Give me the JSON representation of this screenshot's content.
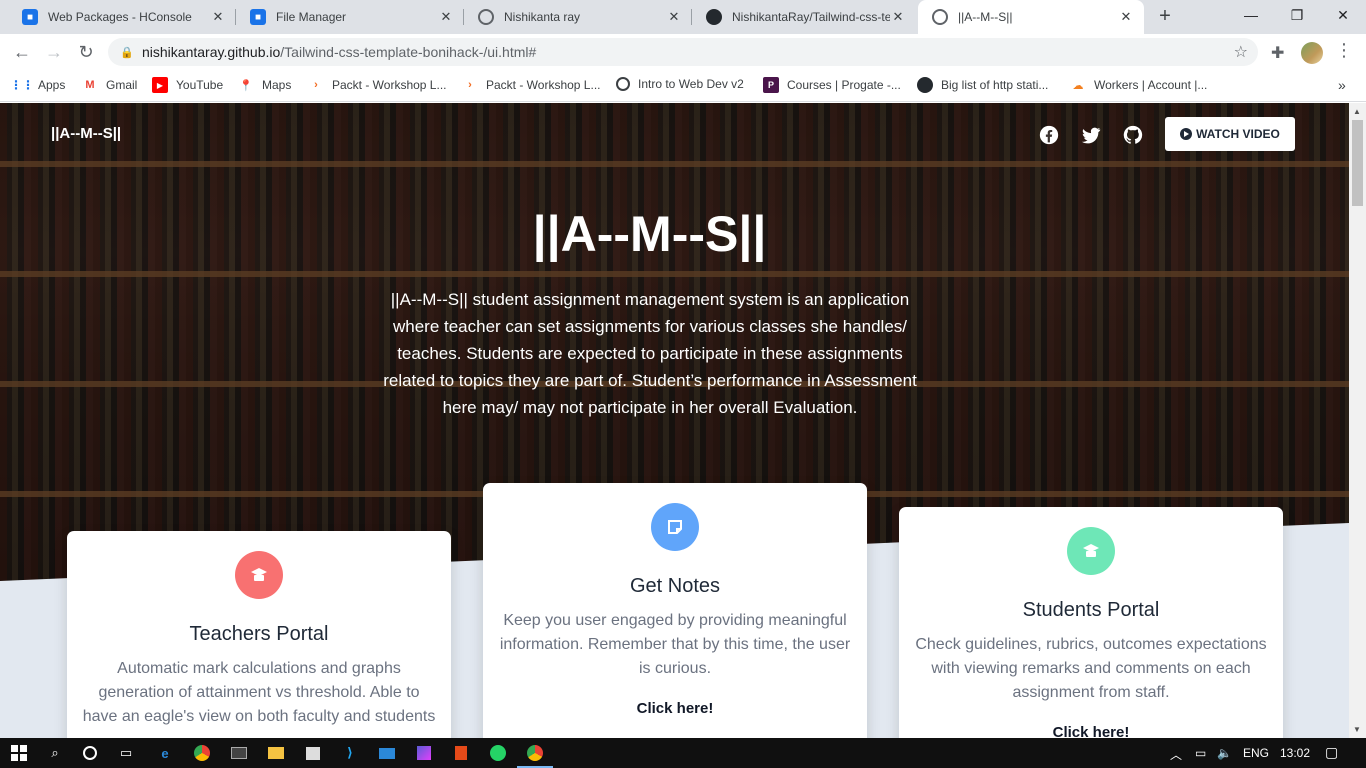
{
  "browser": {
    "tabs": [
      {
        "title": "Web Packages - HConsole",
        "active": false,
        "favicon": "hconsole-icon"
      },
      {
        "title": "File Manager",
        "active": false,
        "favicon": "file-manager-icon"
      },
      {
        "title": "Nishikanta ray",
        "active": false,
        "favicon": "globe-icon"
      },
      {
        "title": "NishikantaRay/Tailwind-css-ter",
        "active": false,
        "favicon": "github-icon"
      },
      {
        "title": "||A--M--S||",
        "active": true,
        "favicon": "globe-icon"
      }
    ],
    "url_host": "nishikantaray.github.io",
    "url_path": "/Tailwind-css-template-bonihack-/ui.html#",
    "bookmarks": [
      {
        "label": "Apps",
        "icon": "apps-grid-icon"
      },
      {
        "label": "Gmail",
        "icon": "gmail-icon"
      },
      {
        "label": "YouTube",
        "icon": "youtube-icon"
      },
      {
        "label": "Maps",
        "icon": "maps-icon"
      },
      {
        "label": "Packt - Workshop L...",
        "icon": "packt-icon"
      },
      {
        "label": "Packt - Workshop L...",
        "icon": "packt-icon"
      },
      {
        "label": "Intro to Web Dev v2",
        "icon": "globe-icon"
      },
      {
        "label": "Courses | Progate -...",
        "icon": "progate-icon"
      },
      {
        "label": "Big list of http stati...",
        "icon": "github-icon"
      },
      {
        "label": "Workers | Account |...",
        "icon": "cloudflare-icon"
      }
    ]
  },
  "page": {
    "brand": "||A--M--S||",
    "watch_video": "WATCH VIDEO",
    "hero_title": "||A--M--S||",
    "hero_description": "||A--M--S|| student assignment management system is an application where teacher can set assignments for various classes she handles/ teaches. Students are expected to participate in these assignments related to topics they are part of. Student’s performance in Assessment here may/ may not participate in her overall Evaluation.",
    "cards": [
      {
        "title": "Teachers Portal",
        "body": "Automatic mark calculations and graphs generation of attainment vs threshold. Able to have an eagle's view on both faculty and students",
        "cta": "",
        "badge_color": "#f87171",
        "icon": "graduation-cap-icon"
      },
      {
        "title": "Get Notes",
        "body": "Keep you user engaged by providing meaningful information. Remember that by this time, the user is curious.",
        "cta": "Click here!",
        "badge_color": "#60a5fa",
        "icon": "sticky-note-icon"
      },
      {
        "title": "Students Portal",
        "body": "Check guidelines, rubrics, outcomes expectations with viewing remarks and comments on each assignment from staff.",
        "cta": "Click here!",
        "badge_color": "#6ee7b7",
        "icon": "graduation-cap-icon"
      }
    ]
  },
  "taskbar": {
    "language": "ENG",
    "time": "13:02"
  }
}
